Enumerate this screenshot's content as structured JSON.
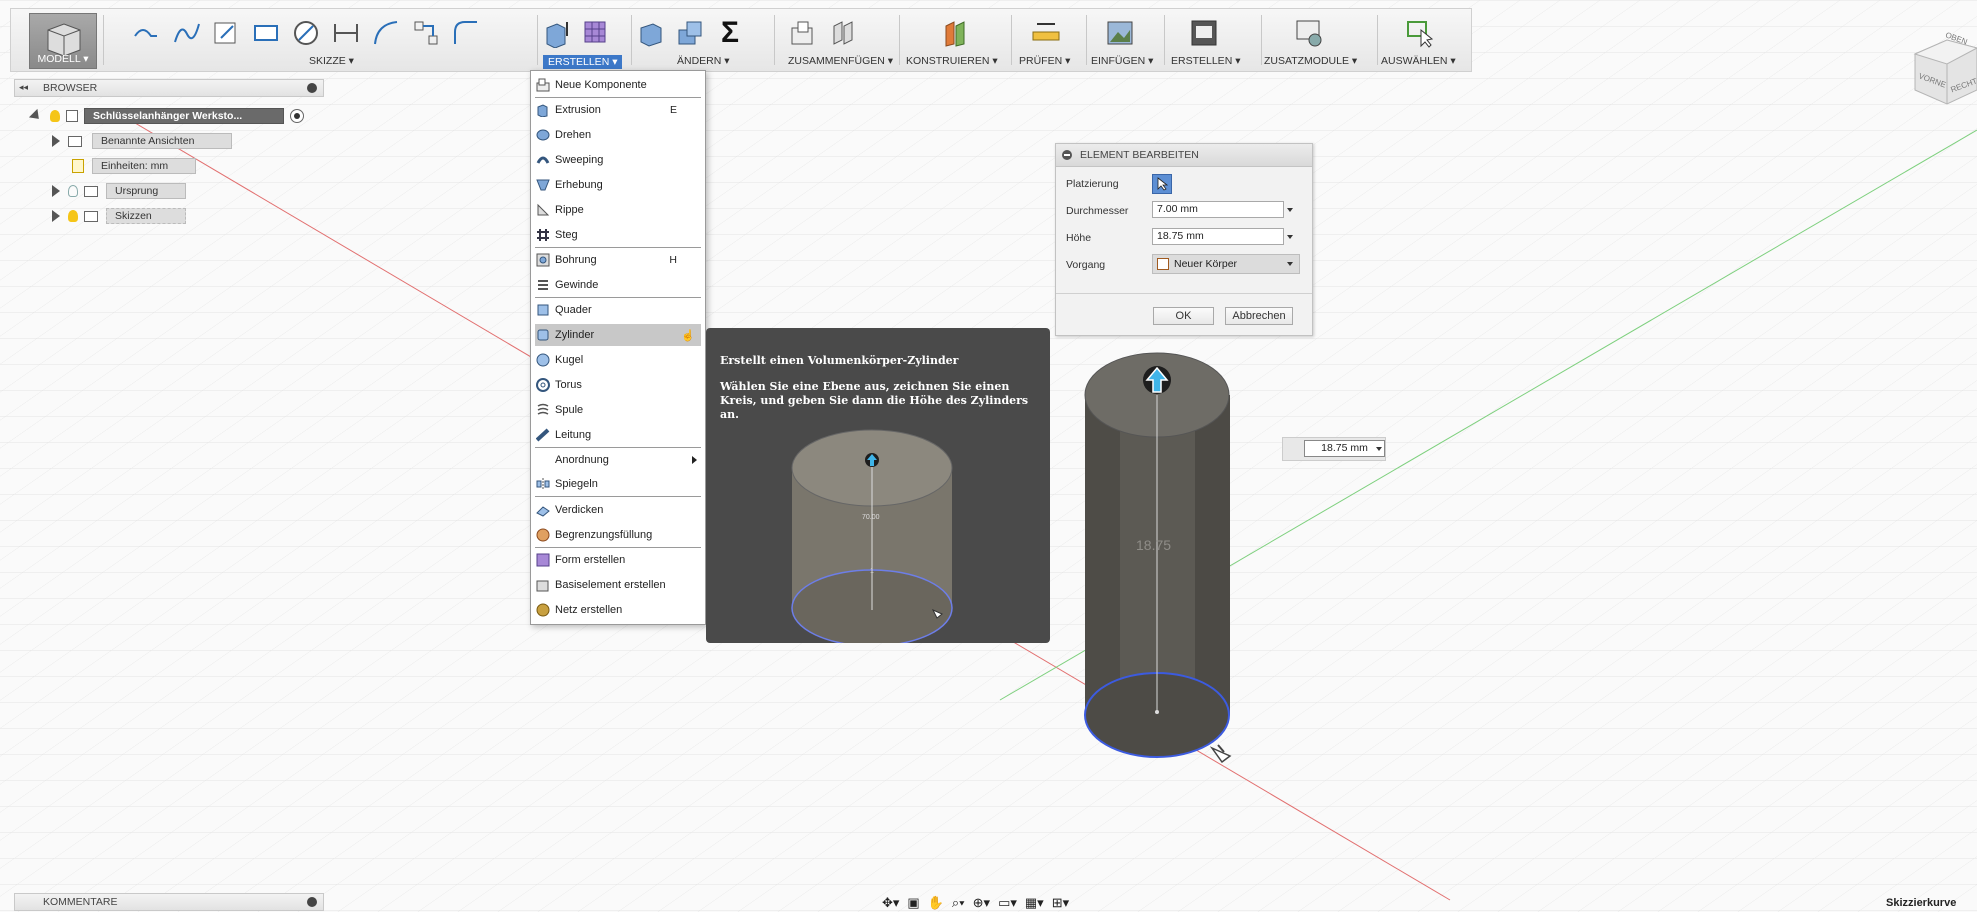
{
  "toolbar": {
    "modell": "MODELL ▾",
    "skizze": "SKIZZE ▾",
    "erstellen": "ERSTELLEN ▾",
    "aendern": "ÄNDERN ▾",
    "zusammenfuegen": "ZUSAMMENFÜGEN ▾",
    "konstruieren": "KONSTRUIEREN ▾",
    "pruefen": "PRÜFEN ▾",
    "einfuegen": "EINFÜGEN ▾",
    "erstellen2": "ERSTELLEN ▾",
    "zusatzmodule": "ZUSATZMODULE ▾",
    "auswaehlen": "AUSWÄHLEN ▾"
  },
  "browser": {
    "title": "BROWSER",
    "root": "Schlüsselanhänger Werksto...",
    "items": [
      "Benannte Ansichten",
      "Einheiten: mm",
      "Ursprung",
      "Skizzen"
    ]
  },
  "menu": {
    "items": [
      {
        "label": "Neue Komponente",
        "shortcut": ""
      },
      {
        "label": "Extrusion",
        "shortcut": "E"
      },
      {
        "label": "Drehen",
        "shortcut": ""
      },
      {
        "label": "Sweeping",
        "shortcut": ""
      },
      {
        "label": "Erhebung",
        "shortcut": ""
      },
      {
        "label": "Rippe",
        "shortcut": ""
      },
      {
        "label": "Steg",
        "shortcut": ""
      },
      {
        "label": "Bohrung",
        "shortcut": "H"
      },
      {
        "label": "Gewinde",
        "shortcut": ""
      },
      {
        "label": "Quader",
        "shortcut": ""
      },
      {
        "label": "Zylinder",
        "shortcut": ""
      },
      {
        "label": "Kugel",
        "shortcut": ""
      },
      {
        "label": "Torus",
        "shortcut": ""
      },
      {
        "label": "Spule",
        "shortcut": ""
      },
      {
        "label": "Leitung",
        "shortcut": ""
      },
      {
        "label": "Anordnung",
        "shortcut": ""
      },
      {
        "label": "Spiegeln",
        "shortcut": ""
      },
      {
        "label": "Verdicken",
        "shortcut": ""
      },
      {
        "label": "Begrenzungsfüllung",
        "shortcut": ""
      },
      {
        "label": "Form erstellen",
        "shortcut": ""
      },
      {
        "label": "Basiselement erstellen",
        "shortcut": ""
      },
      {
        "label": "Netz erstellen",
        "shortcut": ""
      }
    ]
  },
  "tooltip": {
    "title": "Erstellt einen Volumenkörper-Zylinder",
    "body": "Wählen Sie eine Ebene aus, zeichnen Sie einen Kreis, und geben Sie dann die Höhe des Zylinders an.",
    "diameter_label": "70.00",
    "height_label": "1"
  },
  "panel": {
    "title": "ELEMENT BEARBEITEN",
    "placement_label": "Platzierung",
    "diameter_label": "Durchmesser",
    "diameter_value": "7.00 mm",
    "height_label": "Höhe",
    "height_value": "18.75 mm",
    "operation_label": "Vorgang",
    "operation_value": "Neuer Körper",
    "ok": "OK",
    "cancel": "Abbrechen"
  },
  "viewport": {
    "height_input": "18.75 mm",
    "height_text": "18.75"
  },
  "viewcube": {
    "top": "OBEN",
    "front": "VORNE",
    "right": "RECHTS"
  },
  "comments": "KOMMENTARE",
  "status": "Skizzierkurve"
}
